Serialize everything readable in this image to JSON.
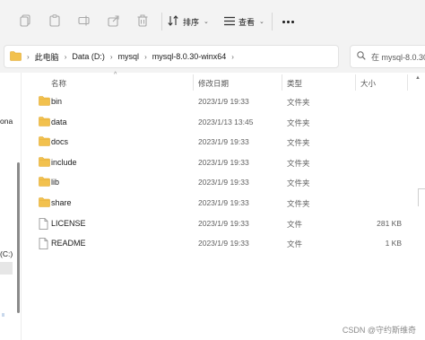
{
  "toolbar": {
    "icons": [
      "copy-icon",
      "paste-icon",
      "rename-icon",
      "share-icon",
      "delete-icon"
    ],
    "sort_label": "排序",
    "view_label": "查看"
  },
  "address": {
    "crumbs": [
      "此电脑",
      "Data (D:)",
      "mysql",
      "mysql-8.0.30-winx64"
    ]
  },
  "search": {
    "placeholder": "在 mysql-8.0.30"
  },
  "columns": {
    "name": "名称",
    "date": "修改日期",
    "type": "类型",
    "size": "大小"
  },
  "nav": {
    "frag_top": "ona",
    "frag_drive": "(C:)"
  },
  "files": [
    {
      "name": "bin",
      "date": "2023/1/9 19:33",
      "type": "文件夹",
      "size": "",
      "kind": "folder"
    },
    {
      "name": "data",
      "date": "2023/1/13 13:45",
      "type": "文件夹",
      "size": "",
      "kind": "folder"
    },
    {
      "name": "docs",
      "date": "2023/1/9 19:33",
      "type": "文件夹",
      "size": "",
      "kind": "folder"
    },
    {
      "name": "include",
      "date": "2023/1/9 19:33",
      "type": "文件夹",
      "size": "",
      "kind": "folder"
    },
    {
      "name": "lib",
      "date": "2023/1/9 19:33",
      "type": "文件夹",
      "size": "",
      "kind": "folder"
    },
    {
      "name": "share",
      "date": "2023/1/9 19:33",
      "type": "文件夹",
      "size": "",
      "kind": "folder"
    },
    {
      "name": "LICENSE",
      "date": "2023/1/9 19:33",
      "type": "文件",
      "size": "281 KB",
      "kind": "file"
    },
    {
      "name": "README",
      "date": "2023/1/9 19:33",
      "type": "文件",
      "size": "1 KB",
      "kind": "file"
    }
  ],
  "watermark": "CSDN @守约斯维奇",
  "colors": {
    "folder": "#f2c14e",
    "folder_dark": "#e0a82e",
    "toolbar_bg": "#f3f3f3"
  }
}
